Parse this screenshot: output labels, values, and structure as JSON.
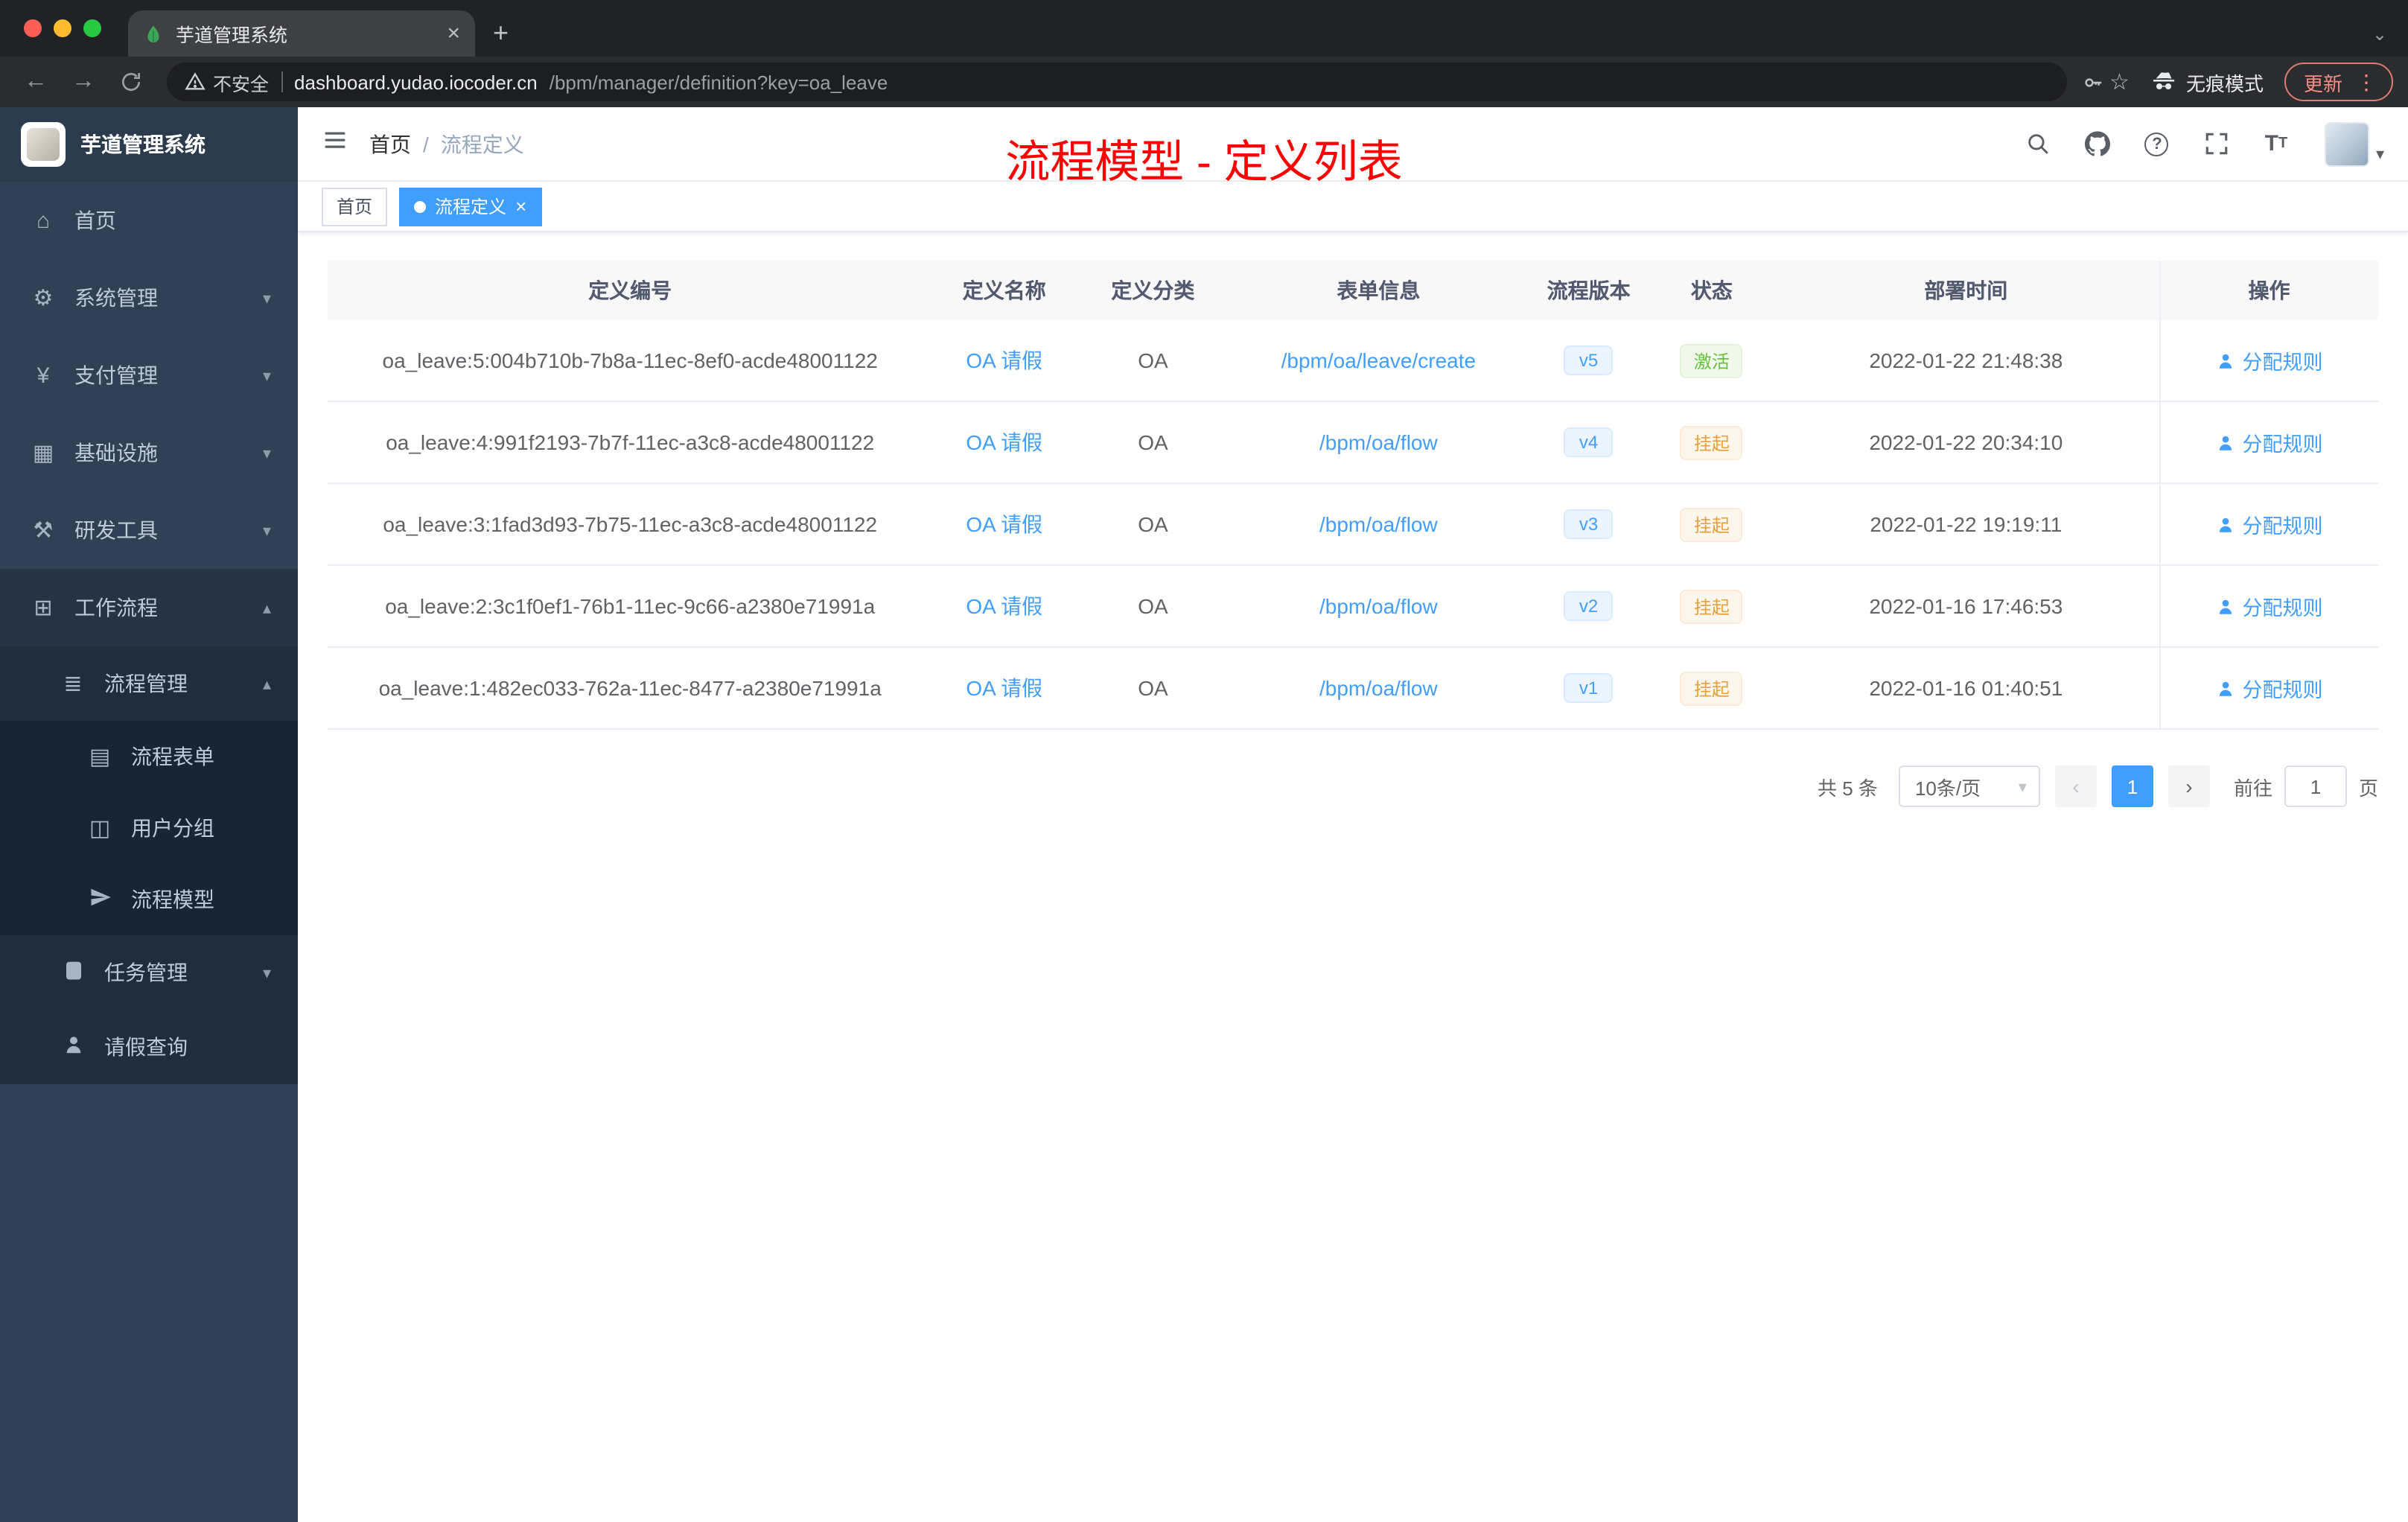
{
  "colors": {
    "accent": "#409eff",
    "success": "#67c23a",
    "warning": "#e6a23c",
    "title_red": "#ff0000",
    "sidebar_bg": "#304156"
  },
  "icons": {
    "close": "×",
    "plus": "+",
    "chevron_down": "⌄",
    "caret_down": "▾",
    "caret_up": "▴",
    "back": "←",
    "forward": "→",
    "star": "☆",
    "dots_vertical": "⋮",
    "home": "⌂",
    "gear": "⚙",
    "yen": "¥",
    "infra": "▦",
    "tools": "⚒",
    "workflow": "⊞",
    "list": "≣",
    "form": "▤",
    "group": "◫",
    "prev": "‹",
    "next": "›",
    "question": "?"
  },
  "browser": {
    "tab_title": "芋道管理系统",
    "security_label": "不安全",
    "url_host": "dashboard.yudao.iocoder.cn",
    "url_path": "/bpm/manager/definition?key=oa_leave",
    "incognito_label": "无痕模式",
    "update_label": "更新"
  },
  "sidebar": {
    "app_title": "芋道管理系统",
    "items": [
      {
        "label": "首页"
      },
      {
        "label": "系统管理"
      },
      {
        "label": "支付管理"
      },
      {
        "label": "基础设施"
      },
      {
        "label": "研发工具"
      },
      {
        "label": "工作流程"
      },
      {
        "label": "流程管理"
      },
      {
        "label": "流程表单"
      },
      {
        "label": "用户分组"
      },
      {
        "label": "流程模型"
      },
      {
        "label": "任务管理"
      },
      {
        "label": "请假查询"
      }
    ]
  },
  "header": {
    "breadcrumb": {
      "first": "首页",
      "separator": "/",
      "last": "流程定义"
    },
    "overlay_title": "流程模型 - 定义列表"
  },
  "tags": [
    {
      "label": "首页"
    },
    {
      "label": "流程定义"
    }
  ],
  "table": {
    "columns": [
      "定义编号",
      "定义名称",
      "定义分类",
      "表单信息",
      "流程版本",
      "状态",
      "部署时间",
      "操作"
    ],
    "rows": [
      {
        "id": "oa_leave:5:004b710b-7b8a-11ec-8ef0-acde48001122",
        "name": "OA 请假",
        "category": "OA",
        "form": "/bpm/oa/leave/create",
        "version": "v5",
        "status": "激活",
        "deploy_time": "2022-01-22 21:48:38",
        "action": "分配规则"
      },
      {
        "id": "oa_leave:4:991f2193-7b7f-11ec-a3c8-acde48001122",
        "name": "OA 请假",
        "category": "OA",
        "form": "/bpm/oa/flow",
        "version": "v4",
        "status": "挂起",
        "deploy_time": "2022-01-22 20:34:10",
        "action": "分配规则"
      },
      {
        "id": "oa_leave:3:1fad3d93-7b75-11ec-a3c8-acde48001122",
        "name": "OA 请假",
        "category": "OA",
        "form": "/bpm/oa/flow",
        "version": "v3",
        "status": "挂起",
        "deploy_time": "2022-01-22 19:19:11",
        "action": "分配规则"
      },
      {
        "id": "oa_leave:2:3c1f0ef1-76b1-11ec-9c66-a2380e71991a",
        "name": "OA 请假",
        "category": "OA",
        "form": "/bpm/oa/flow",
        "version": "v2",
        "status": "挂起",
        "deploy_time": "2022-01-16 17:46:53",
        "action": "分配规则"
      },
      {
        "id": "oa_leave:1:482ec033-762a-11ec-8477-a2380e71991a",
        "name": "OA 请假",
        "category": "OA",
        "form": "/bpm/oa/flow",
        "version": "v1",
        "status": "挂起",
        "deploy_time": "2022-01-16 01:40:51",
        "action": "分配规则"
      }
    ]
  },
  "pagination": {
    "total": "共 5 条",
    "page_size": "10条/页",
    "current_page": "1",
    "goto_label": "前往",
    "goto_value": "1",
    "page_unit": "页"
  }
}
